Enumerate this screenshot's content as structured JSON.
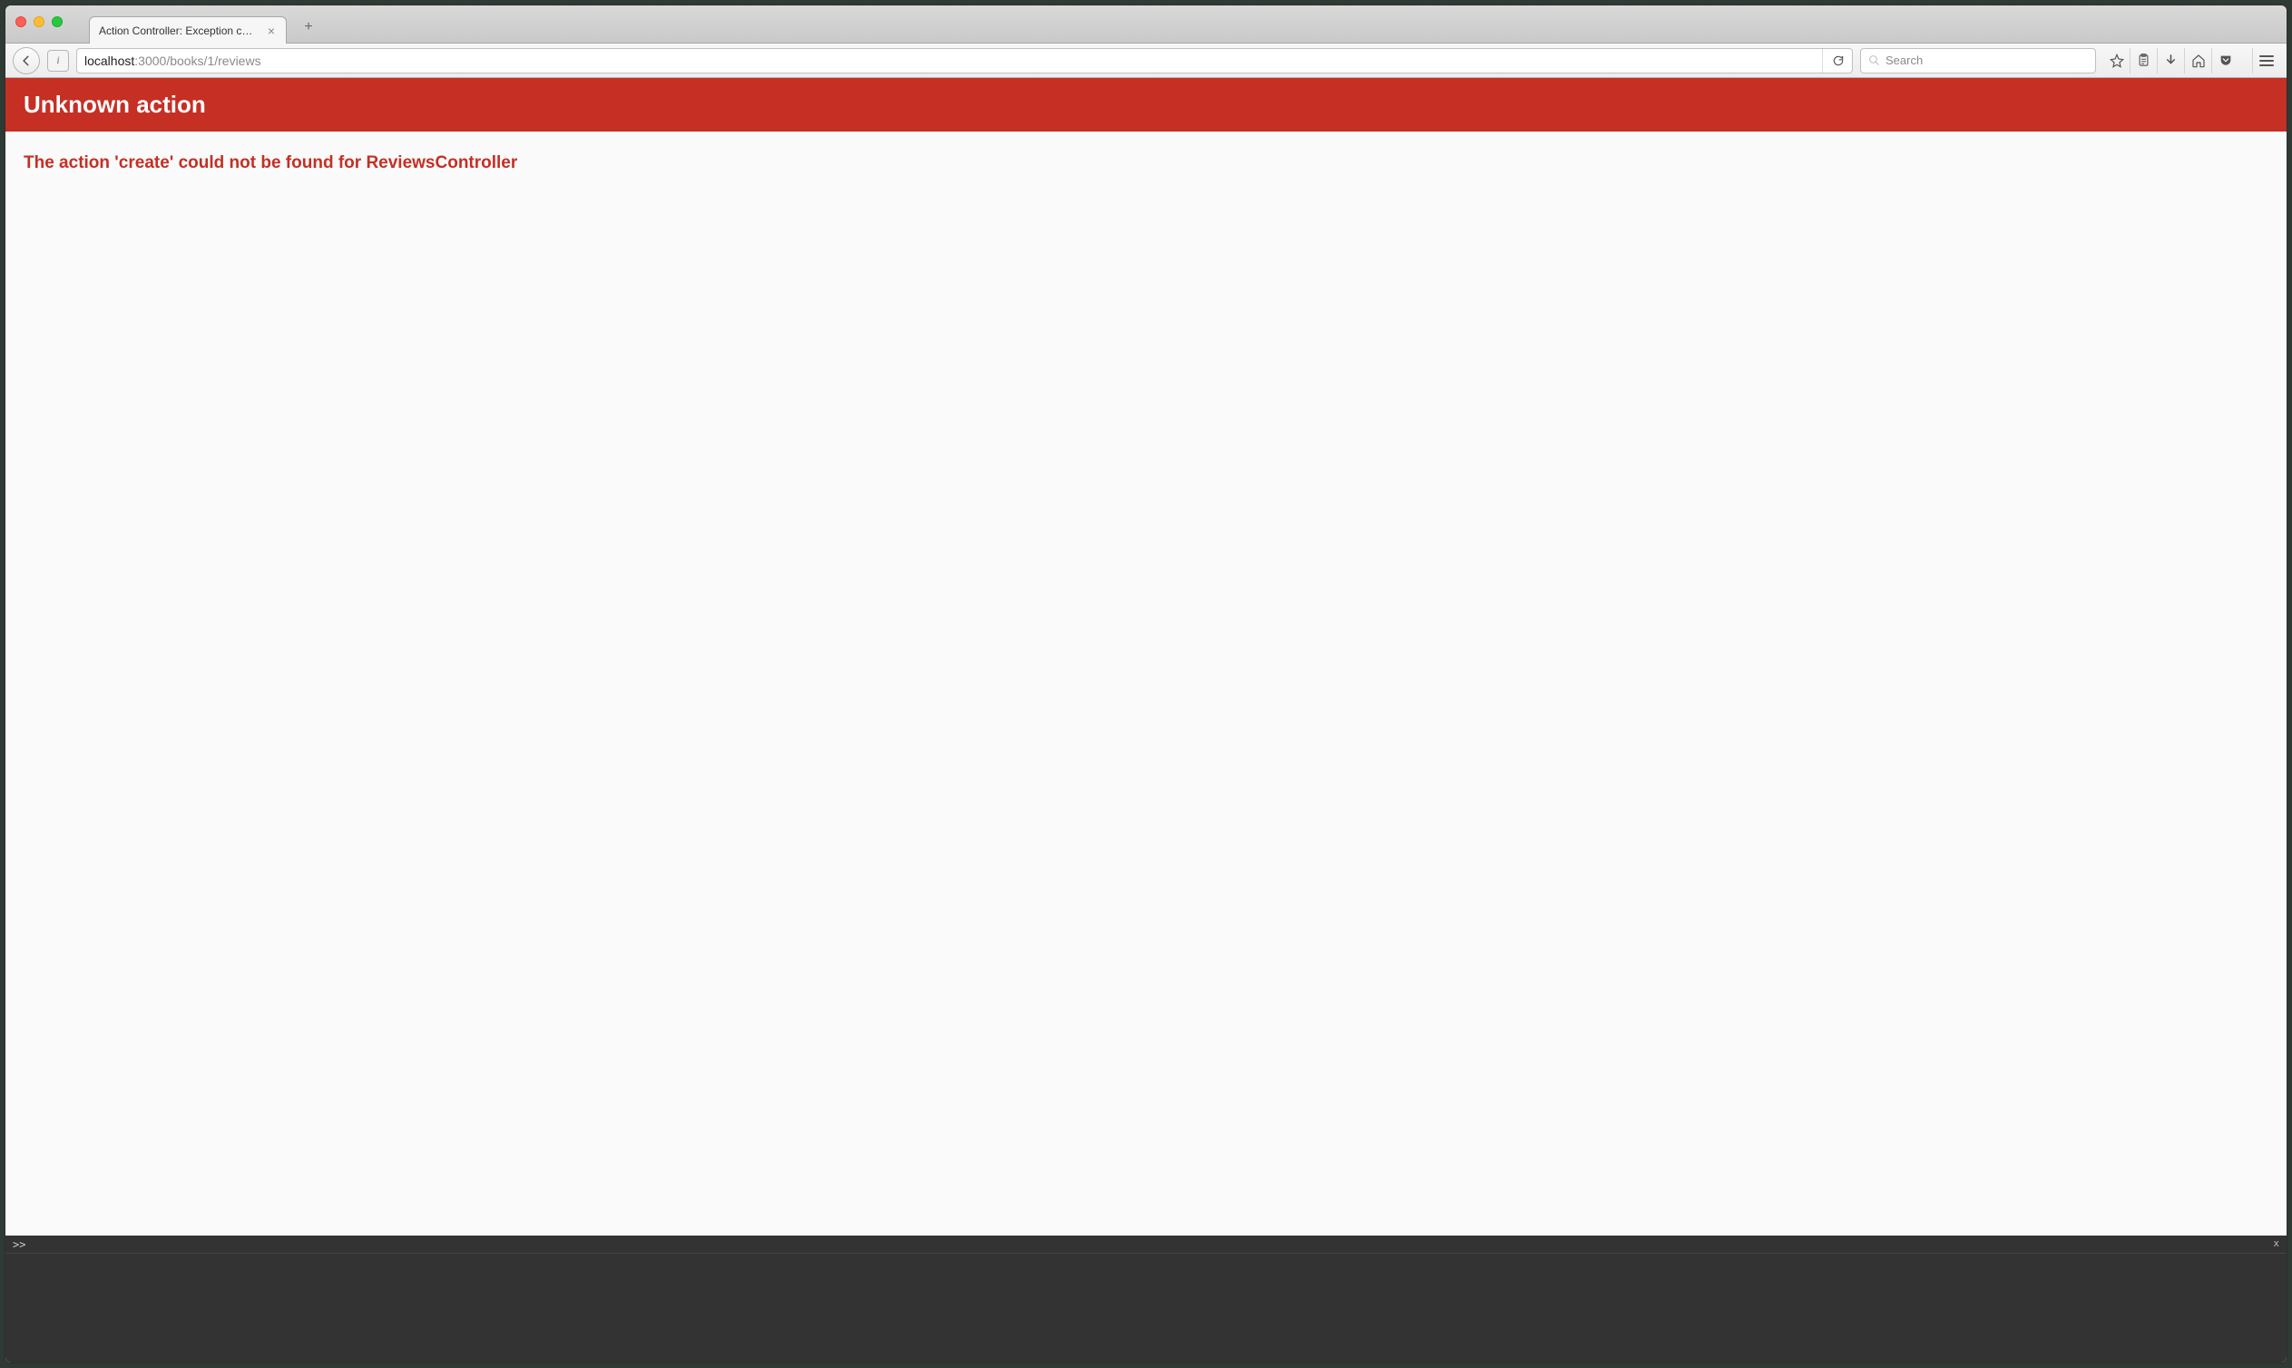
{
  "window": {
    "tab_title": "Action Controller: Exception ca...",
    "new_tab_glyph": "+",
    "close_tab_glyph": "×"
  },
  "urlbar": {
    "host": "localhost",
    "port": ":3000",
    "path": "/books/1/reviews",
    "search_placeholder": "Search"
  },
  "page": {
    "header": "Unknown action",
    "message": "The action 'create' could not be found for ReviewsController"
  },
  "console": {
    "prompt": ">>",
    "close_glyph": "x"
  },
  "colors": {
    "rails_red": "#c52f24",
    "console_bg": "#333333"
  }
}
